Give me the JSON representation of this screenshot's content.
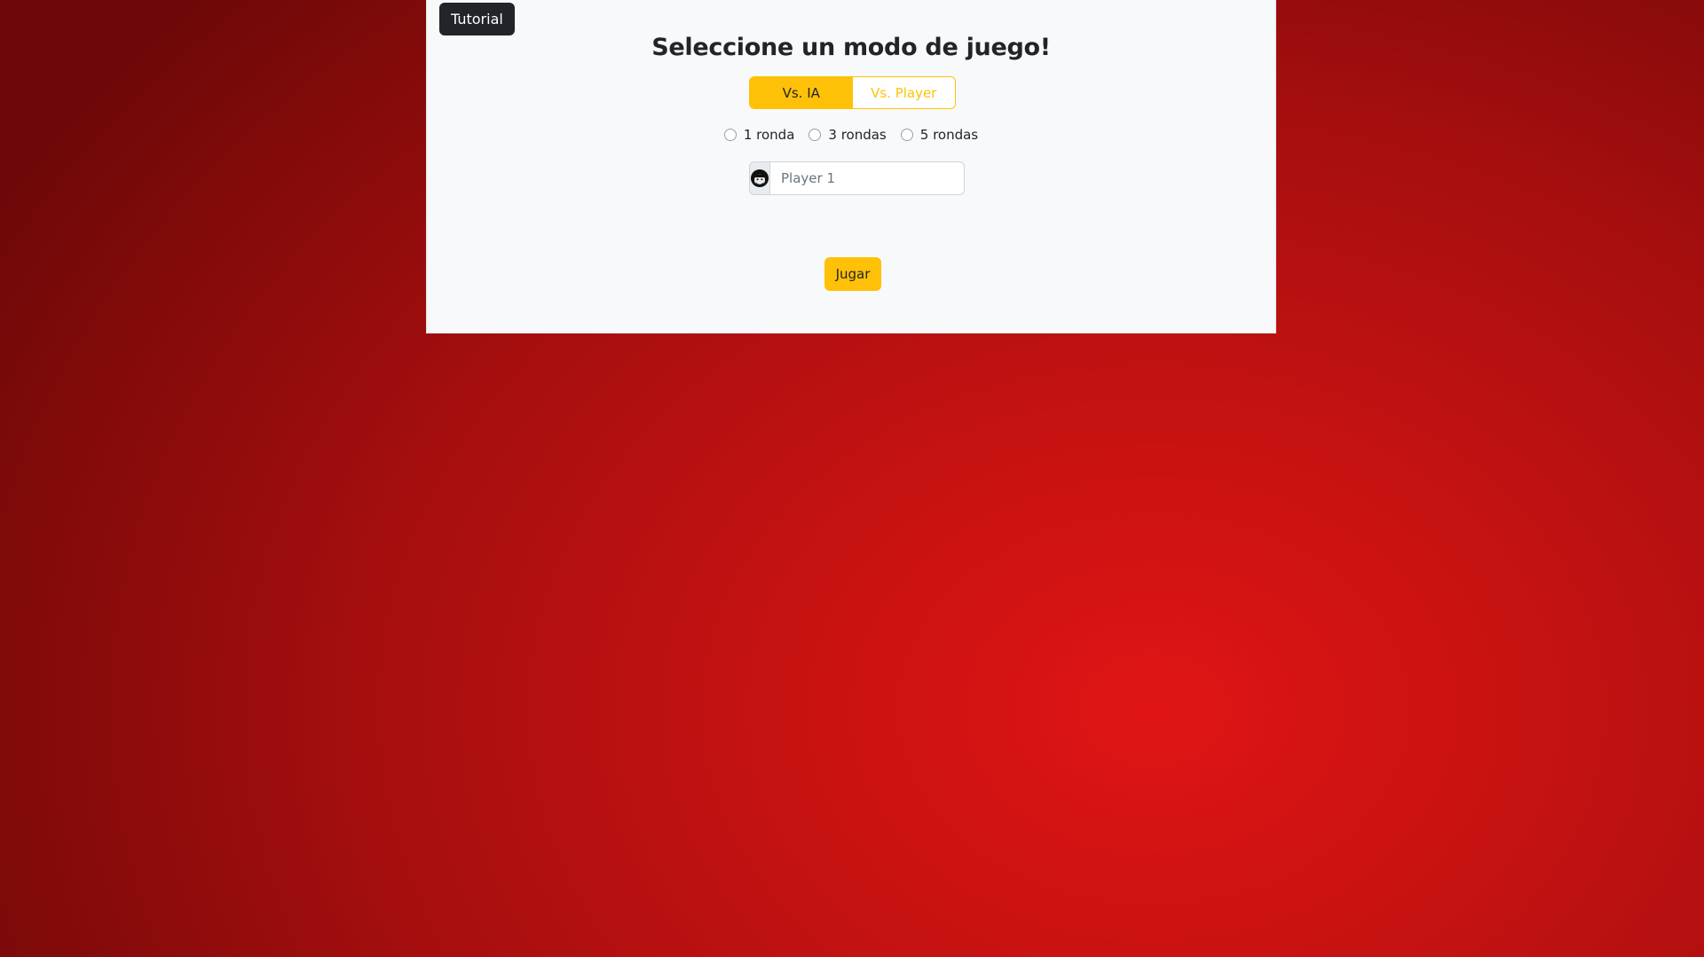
{
  "header": {
    "tutorial_label": "Tutorial",
    "title": "Seleccione un modo de juego!"
  },
  "mode": {
    "options": [
      {
        "label": "Vs. IA",
        "selected": true
      },
      {
        "label": "Vs. Player",
        "selected": false
      }
    ]
  },
  "rounds": {
    "options": [
      {
        "label": "1 ronda",
        "selected": false
      },
      {
        "label": "3 rondas",
        "selected": false
      },
      {
        "label": "5 rondas",
        "selected": false
      }
    ]
  },
  "player": {
    "avatar_icon": "player-avatar-icon",
    "name_value": "",
    "name_placeholder": "Player 1"
  },
  "actions": {
    "play_label": "Jugar"
  },
  "colors": {
    "accent": "#ffc107",
    "dark_button": "#212529",
    "background": "#cc1212",
    "panel": "#f8f9fa"
  }
}
